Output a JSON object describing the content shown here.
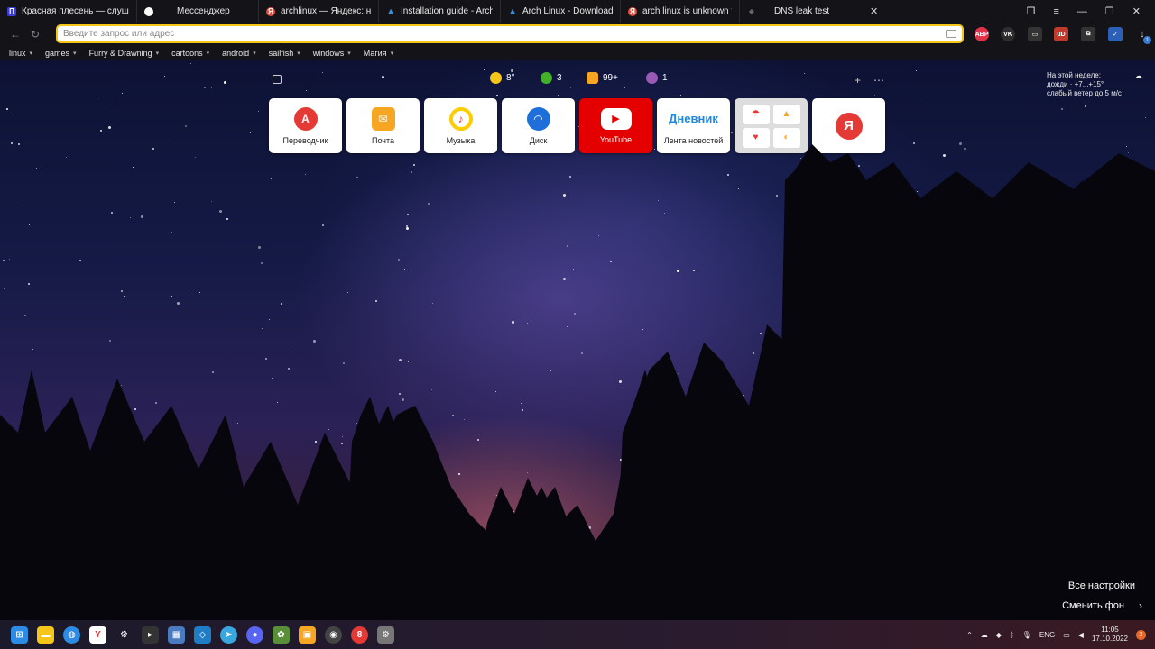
{
  "tabs": [
    {
      "label": "Красная плесень — слуша",
      "favicon": "tile-icon",
      "fav_color": "#3d3dd9"
    },
    {
      "label": "Мессенджер",
      "favicon": "chat-icon",
      "fav_color": "#ffffff"
    },
    {
      "label": "archlinux — Яндекс: нашл",
      "favicon": "yandex-icon",
      "fav_color": "#e74c3c"
    },
    {
      "label": "Installation guide - ArchW",
      "favicon": "arch-icon",
      "fav_color": "#3a8dde"
    },
    {
      "label": "Arch Linux - Downloads",
      "favicon": "arch-icon",
      "fav_color": "#3a8dde"
    },
    {
      "label": "arch linux is unknown trust",
      "favicon": "yandex-icon",
      "fav_color": "#e74c3c"
    },
    {
      "label": "DNS leak test",
      "favicon": "leak-icon",
      "fav_color": "#666666"
    }
  ],
  "omnibox": {
    "placeholder": "Введите запрос или адрес"
  },
  "extensions": [
    {
      "name": "abp-icon",
      "text": "ABP",
      "color": "#e0334a"
    },
    {
      "name": "vk-icon",
      "text": "VK",
      "color": "#2e2e2e"
    },
    {
      "name": "reader-icon",
      "text": "",
      "color": "#333333"
    },
    {
      "name": "ublock-icon",
      "text": "uD",
      "color": "#c0392b"
    },
    {
      "name": "translate-icon",
      "text": "",
      "color": "#333333"
    },
    {
      "name": "shield-icon",
      "text": "",
      "color": "#2b5fb8"
    }
  ],
  "downloads_badge": "1",
  "bookmarks": [
    "linux",
    "games",
    "Furry & Drawning",
    "cartoons",
    "android",
    "sailfish",
    "windows",
    "Магия"
  ],
  "info": {
    "weather": "8°",
    "traffic": "3",
    "mail": "99+",
    "messages": "1"
  },
  "weather_widget": {
    "line1": "На этой неделе:",
    "line2": "дожди · +7...+15°",
    "line3": "слабый ветер до 5 м/с"
  },
  "tiles": [
    {
      "label": "Переводчик",
      "icon": "translate-icon",
      "color": "#e53935"
    },
    {
      "label": "Почта",
      "icon": "mail-icon",
      "color": "#f6a623"
    },
    {
      "label": "Музыка",
      "icon": "music-icon",
      "color": "#ffcc00"
    },
    {
      "label": "Диск",
      "icon": "disk-icon",
      "color": "#1e6fd9"
    },
    {
      "label": "YouTube",
      "icon": "youtube-icon",
      "color": "#ffffff"
    },
    {
      "label": "Лента новостей",
      "icon": "dnevnik-logo",
      "color": "#1e88e5",
      "logo_text": "Дневник"
    },
    {
      "label": "",
      "icon": "group-icon",
      "color": "#dddddd"
    },
    {
      "label": "",
      "icon": "yandex-icon",
      "color": "#e53935",
      "logo_text": "Я"
    }
  ],
  "bottom": {
    "settings": "Все настройки",
    "background": "Сменить фон"
  },
  "tray": {
    "lang": "ENG",
    "time": "11:05",
    "date": "17.10.2022",
    "notif": "2"
  }
}
